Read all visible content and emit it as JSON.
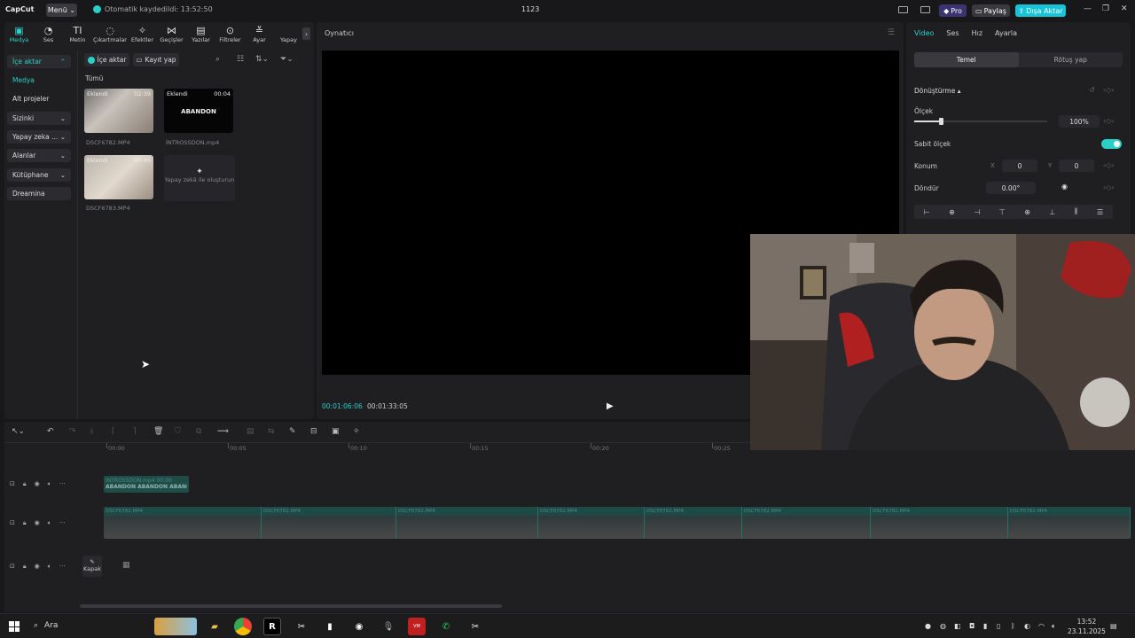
{
  "app": {
    "logo": "CapCut",
    "menu_label": "Menü ⌄",
    "autosave": "Otomatik kaydedildi: 13:52:50",
    "project_title": "1123",
    "pro_label": "Pro",
    "share_label": "Paylaş",
    "export_label": "Dışa Aktar",
    "accent": "#2ad0c8"
  },
  "media_tabs": [
    {
      "label": "Medya",
      "icon": "▣"
    },
    {
      "label": "Ses",
      "icon": "◔"
    },
    {
      "label": "Metin",
      "icon": "TI"
    },
    {
      "label": "Çıkartmalar",
      "icon": "◌"
    },
    {
      "label": "Efektler",
      "icon": "✧"
    },
    {
      "label": "Geçişler",
      "icon": "⋈"
    },
    {
      "label": "Yazılar",
      "icon": "▤"
    },
    {
      "label": "Filtreler",
      "icon": "⊙"
    },
    {
      "label": "Ayar",
      "icon": "≚"
    },
    {
      "label": "Yapay",
      "icon": ""
    }
  ],
  "sidebar": {
    "items": [
      {
        "label": "İçe aktar",
        "chev": "⌃"
      },
      {
        "label": "Medya",
        "chev": ""
      },
      {
        "label": "Alt projeler",
        "chev": ""
      },
      {
        "label": "Sizinki",
        "chev": "⌄"
      },
      {
        "label": "Yapay zeka ...",
        "chev": "⌄"
      },
      {
        "label": "Alanlar",
        "chev": "⌄"
      },
      {
        "label": "Kütüphane",
        "chev": "⌄"
      },
      {
        "label": "Dreamina",
        "chev": ""
      }
    ]
  },
  "media": {
    "import_label": "İçe aktar",
    "record_label": "Kayıt yap",
    "all_label": "Tümü",
    "clips": [
      {
        "tag": "Eklendi",
        "duration": "02:39",
        "name": "DSCF6782.MP4",
        "text": ""
      },
      {
        "tag": "Eklendi",
        "duration": "00:04",
        "name": "İNTROSSDON.mp4",
        "text": "ABANDON"
      },
      {
        "tag": "Eklendi",
        "duration": "00:45",
        "name": "DSCF6783.MP4",
        "text": ""
      }
    ],
    "ai_create": "Yapay zekâ ile oluşturun"
  },
  "player": {
    "title": "Oynatıcı",
    "current_time": "00:01:06:06",
    "total_time": "00:01:33:05"
  },
  "props": {
    "tabs": [
      "Video",
      "Ses",
      "Hız",
      "Ayarla"
    ],
    "segments": [
      "Temel",
      "Rötuş yap"
    ],
    "transform_label": "Dönüştürme ▴",
    "scale_label": "Ölçek",
    "scale_value": "100%",
    "scale_level": 0.2,
    "uniform_label": "Sabit ölçek",
    "position_label": "Konum",
    "x_label": "X",
    "x_value": "0",
    "y_label": "Y",
    "y_value": "0",
    "rotate_label": "Döndür",
    "rotate_value": "0.00°"
  },
  "timeline": {
    "ticks": [
      "00:00",
      "00:05",
      "00:10",
      "00:15",
      "00:20",
      "00:25"
    ],
    "intro_clip_label": "İNTROSSDON.mp4  00:00",
    "intro_text": "ABANDON ABANDON ABAND",
    "main_clip_labels": [
      "DSCF6782.MP4",
      "DSCF6782.MP4",
      "DSCF6782.MP4",
      "DSCF6782.MP4",
      "DSCF6782.MP4",
      "DSCF6782.MP4",
      "DSCF6782.MP4",
      "DSCF6782.MP4"
    ],
    "cover_label": "Kapak"
  },
  "taskbar": {
    "search_label": "Ara",
    "time": "13:52",
    "date": "23.11.2025"
  }
}
